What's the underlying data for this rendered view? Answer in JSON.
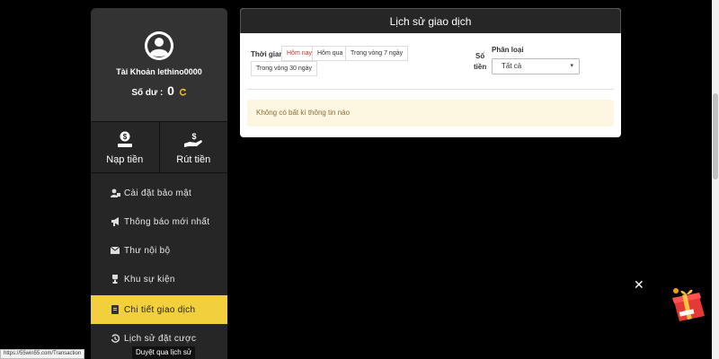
{
  "profile": {
    "account_label": "Tài Khoản lethino0000",
    "balance_label": "Số dư :",
    "balance_value": "0"
  },
  "money_actions": [
    {
      "label": "Nạp tiền",
      "icon": "dollar-hand-icon"
    },
    {
      "label": "Rút tiền",
      "icon": "withdraw-hand-icon"
    }
  ],
  "menu": [
    {
      "label": "Cài đặt bảo mật",
      "icon": "user-lock-icon"
    },
    {
      "label": "Thông báo mới nhất",
      "icon": "megaphone-icon"
    },
    {
      "label": "Thư nội bộ",
      "icon": "envelope-icon"
    },
    {
      "label": "Khu sự kiện",
      "icon": "trophy-icon"
    },
    {
      "label": "Chi tiết giao dịch",
      "icon": "document-icon",
      "active": true
    },
    {
      "label": "Lịch sử đặt cược",
      "icon": "history-icon"
    }
  ],
  "panel": {
    "title": "Lịch sử giao dịch",
    "time_label": "Thời gian",
    "time_options": [
      "Hôm nay",
      "Hôm qua",
      "Trong vòng 7 ngày",
      "Trong vòng 30 ngày"
    ],
    "selected_time": "Hôm nay",
    "amount_label_line1": "Số",
    "amount_label_line2": "tiền",
    "category_label": "Phân loại",
    "category_value": "Tất cả",
    "empty_message": "Không có bất kì thông tin nào"
  },
  "status_url": "https://55win55.com/Transaction",
  "tooltip": "Duyệt qua lịch sử",
  "colors": {
    "accent": "#f2d03d",
    "sidebar_bg": "#262626",
    "notice_bg": "#fdf6e0"
  }
}
